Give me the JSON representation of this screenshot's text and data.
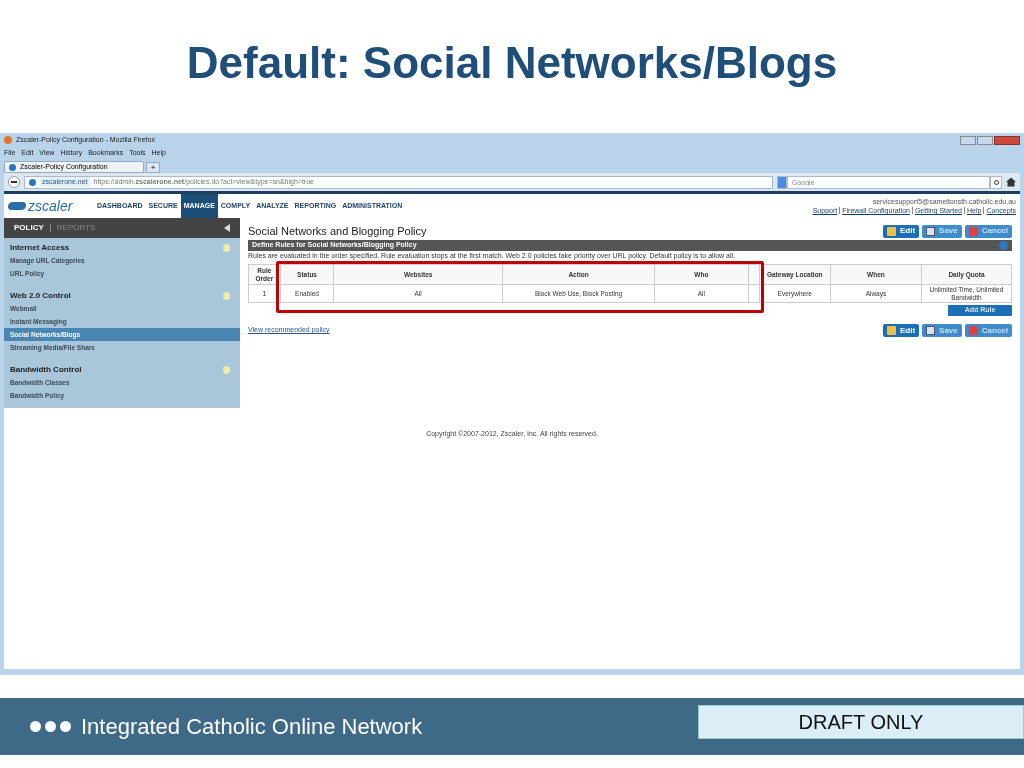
{
  "slide": {
    "title": "Default: Social Networks/Blogs"
  },
  "browser": {
    "window_title": "Zscaler-Policy Configuration - Mozilla Firefox",
    "menu": [
      "File",
      "Edit",
      "View",
      "History",
      "Bookmarks",
      "Tools",
      "Help"
    ],
    "tab": {
      "label": "Zscaler-Policy Configuration",
      "new_tab": "+"
    },
    "site_badge": "zscalerone.net",
    "url": "https://admin.**zscalerone.net**/policies.do?act=view&type=sn&high=true",
    "search": {
      "placeholder": "Google"
    }
  },
  "app": {
    "logo": "zscaler",
    "nav": [
      {
        "label": "DASHBOARD",
        "selected": false
      },
      {
        "label": "SECURE",
        "selected": false
      },
      {
        "label": "MANAGE",
        "selected": true
      },
      {
        "label": "COMPLY",
        "selected": false
      },
      {
        "label": "ANALYZE",
        "selected": false
      },
      {
        "label": "REPORTING",
        "selected": false
      },
      {
        "label": "ADMINISTRATION",
        "selected": false
      }
    ],
    "user_email": "servicesupport5@sameltonsth.catholic.edu.au",
    "links": [
      "Support",
      "Firewall Configuration",
      "Getting Started",
      "Help",
      "Concepts"
    ]
  },
  "sidebar": {
    "tabs": [
      {
        "label": "POLICY",
        "selected": true
      },
      {
        "label": "REPORTS",
        "selected": false
      }
    ],
    "sections": [
      {
        "title": "Internet Access",
        "items": [
          {
            "label": "Manage URL Categories",
            "selected": false
          },
          {
            "label": "URL Policy",
            "selected": false
          }
        ]
      },
      {
        "title": "Web 2.0 Control",
        "items": [
          {
            "label": "Webmail",
            "selected": false
          },
          {
            "label": "Instant Messaging",
            "selected": false
          },
          {
            "label": "Social Networks/Blogs",
            "selected": true
          },
          {
            "label": "Streaming Media/File Share",
            "selected": false
          }
        ]
      },
      {
        "title": "Bandwidth Control",
        "items": [
          {
            "label": "Bandwidth Classes",
            "selected": false
          },
          {
            "label": "Bandwidth Policy",
            "selected": false
          }
        ]
      }
    ]
  },
  "page": {
    "title": "Social Networks and Blogging Policy",
    "buttons": [
      {
        "kind": "edit",
        "label": "Edit"
      },
      {
        "kind": "save",
        "label": "Save"
      },
      {
        "kind": "cancel",
        "label": "Cancel"
      }
    ],
    "panel_title": "Define Rules for Social Networks/Blogging Policy",
    "note": "Rules are evaluated in the order specified. Rule evaluation stops at the first match. Web 2.0 policies take priority over URL policy. Default policy is to allow all.",
    "table": {
      "columns": [
        "Rule Order",
        "Status",
        "Websites",
        "Action",
        "Who",
        "",
        "Gateway Location",
        "When",
        "Daily Quota"
      ],
      "rows": [
        [
          "1",
          "Enabled",
          "All",
          "Block Web Use, Block Posting",
          "All",
          "",
          "Everywhere",
          "Always",
          "Unlimited Time, Unlimited Bandwidth"
        ]
      ]
    },
    "add_rule": "Add Rule",
    "recommended_link": "View recommended policy",
    "bottom_buttons": [
      {
        "kind": "edit",
        "label": "Edit"
      },
      {
        "kind": "save",
        "label": "Save"
      },
      {
        "kind": "cancel",
        "label": "Cancel"
      }
    ],
    "copyright": "Copyright ©2007-2012, Zscaler, Inc. All rights reserved."
  },
  "footer": {
    "text": "Integrated Catholic Online Network",
    "badge": "DRAFT ONLY"
  }
}
